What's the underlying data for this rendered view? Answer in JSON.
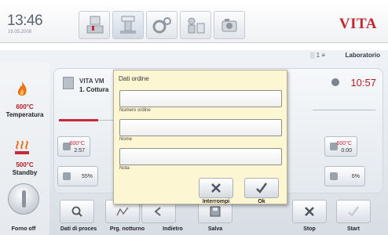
{
  "header": {
    "time": "13:46",
    "date": "16.05.2008",
    "brand": "VITA",
    "tabs": [
      {
        "icon": "program-icon"
      },
      {
        "icon": "furnace-icon"
      },
      {
        "icon": "settings-icon"
      },
      {
        "icon": "user-tools-icon"
      },
      {
        "icon": "camera-icon"
      }
    ]
  },
  "status": {
    "label": "Laboratorio",
    "icons": "░ 1  ≡"
  },
  "left_panel": {
    "temperature_value": "600°C",
    "temperature_label": "Temperatura",
    "standby_value": "500°C",
    "standby_label": "Standby",
    "power_label": "Forno off"
  },
  "program": {
    "name": "VITA VM",
    "phase": "1. Cottura",
    "time": "10:57",
    "params_left": [
      {
        "value_red": "600°C",
        "value": "2:57"
      },
      {
        "value": "55%"
      }
    ],
    "params_right": [
      {
        "value_red": "600°C",
        "value": "0:00"
      },
      {
        "value": "6%"
      }
    ]
  },
  "dialog": {
    "title": "Dati ordine",
    "fields": [
      {
        "label": "Numero ordine",
        "value": ""
      },
      {
        "label": "Nome",
        "value": ""
      },
      {
        "label": "Nota",
        "value": ""
      }
    ],
    "buttons": {
      "cancel": "Interrompi",
      "ok": "Ok"
    }
  },
  "bottom_bar": {
    "order_data": "Dati di proces",
    "night_program": "Prg. notturno",
    "back": "Indietro",
    "save": "Salva",
    "stop": "Stop",
    "start": "Start"
  },
  "colors": {
    "accent_red": "#c0292f",
    "dialog_bg": "#fdf6d3"
  }
}
